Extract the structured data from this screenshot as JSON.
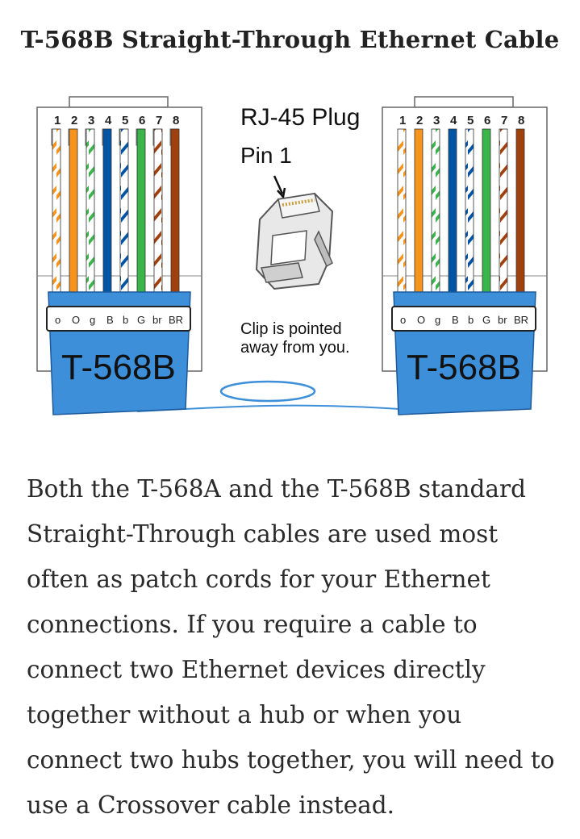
{
  "page": {
    "title": "T-568B Straight-Through Ethernet Cable"
  },
  "diagram": {
    "left_connector": {
      "pin_numbers": [
        "1",
        "2",
        "3",
        "4",
        "5",
        "6",
        "7",
        "8"
      ],
      "color_codes": [
        "o",
        "O",
        "g",
        "B",
        "b",
        "G",
        "br",
        "BR"
      ],
      "standard_label": "T-568B"
    },
    "right_connector": {
      "pin_numbers": [
        "1",
        "2",
        "3",
        "4",
        "5",
        "6",
        "7",
        "8"
      ],
      "color_codes": [
        "o",
        "O",
        "g",
        "B",
        "b",
        "G",
        "br",
        "BR"
      ],
      "standard_label": "T-568B"
    },
    "plug_title": "RJ-45 Plug",
    "pin1_label": "Pin 1",
    "clip_note_line1": "Clip is pointed",
    "clip_note_line2": "away from you.",
    "wire_colors": {
      "orange": "#f7941d",
      "green": "#39b54a",
      "blue": "#0054a6",
      "brown": "#a0410d",
      "jacket_blue": "#3d8fd9"
    }
  },
  "article": {
    "paragraph": "Both the T-568A and the T-568B standard Straight-Through cables are used most often as patch cords for your Ethernet connections. If you require a cable to connect two Ethernet devices directly together without a hub or when you connect two hubs together, you will need to use a Crossover cable instead."
  }
}
